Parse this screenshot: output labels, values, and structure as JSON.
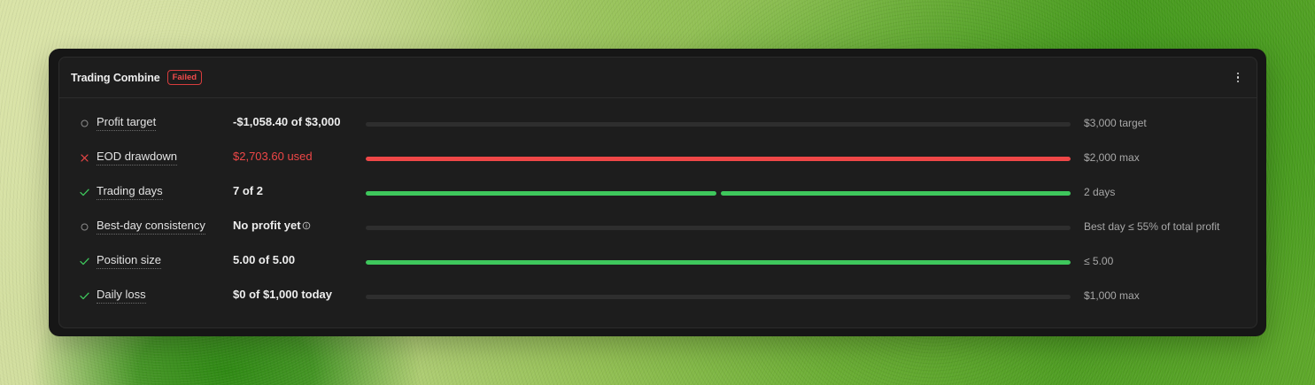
{
  "card": {
    "title": "Trading Combine",
    "status": "Failed",
    "menu_icon": "more-vertical-icon"
  },
  "colors": {
    "success": "#3ec75c",
    "danger": "#ef4747",
    "track": "#2e2e2e",
    "pending": "#8a8a8a"
  },
  "rules": [
    {
      "status": "pending",
      "icon": "circle-icon",
      "label": "Profit target",
      "value": "-$1,058.40 of $3,000",
      "progress": 0,
      "segments": 1,
      "limit": "$3,000 target"
    },
    {
      "status": "failed",
      "icon": "x-icon",
      "label": "EOD drawdown",
      "value": "$2,703.60 used",
      "progress": 1,
      "segments": 1,
      "limit": "$2,000 max"
    },
    {
      "status": "passed",
      "icon": "check-icon",
      "label": "Trading days",
      "value": "7 of 2",
      "progress": 1,
      "segments": 2,
      "limit": "2 days"
    },
    {
      "status": "pending",
      "icon": "circle-icon",
      "label": "Best-day consistency",
      "value": "No profit yet",
      "has_info": true,
      "progress": 0,
      "segments": 1,
      "limit": "Best day ≤ 55% of total profit"
    },
    {
      "status": "passed",
      "icon": "check-icon",
      "label": "Position size",
      "value": "5.00 of 5.00",
      "progress": 1,
      "segments": 1,
      "limit": "≤ 5.00"
    },
    {
      "status": "passed",
      "icon": "check-icon",
      "label": "Daily loss",
      "value": "$0 of $1,000 today",
      "progress": 0,
      "segments": 1,
      "limit": "$1,000 max"
    }
  ]
}
